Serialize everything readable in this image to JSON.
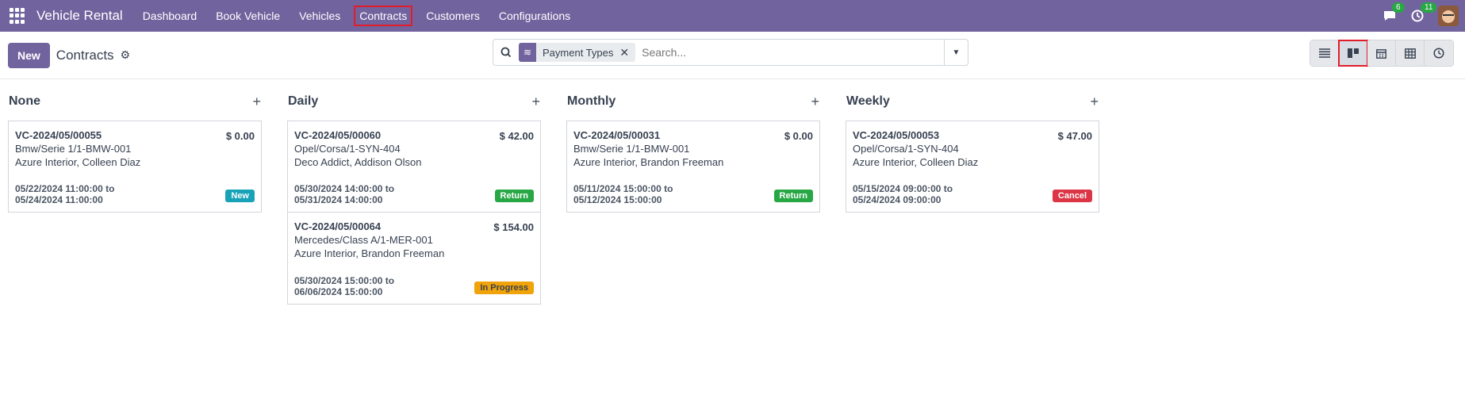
{
  "app": {
    "name": "Vehicle Rental",
    "menu": [
      "Dashboard",
      "Book Vehicle",
      "Vehicles",
      "Contracts",
      "Customers",
      "Configurations"
    ],
    "active_menu": "Contracts",
    "messages_count": "6",
    "activities_count": "11"
  },
  "control": {
    "new_label": "New",
    "title": "Contracts",
    "facet_label": "Payment Types",
    "search_placeholder": "Search..."
  },
  "kanban": {
    "columns": [
      {
        "title": "None",
        "cards": [
          {
            "ref": "VC-2024/05/00055",
            "amount": "$ 0.00",
            "vehicle": "Bmw/Serie 1/1-BMW-001",
            "customer": "Azure Interior, Colleen Diaz",
            "from": "05/22/2024 11:00:00 to",
            "to": "05/24/2024 11:00:00",
            "status": "New",
            "status_color": "#17a2b8"
          }
        ]
      },
      {
        "title": "Daily",
        "cards": [
          {
            "ref": "VC-2024/05/00060",
            "amount": "$ 42.00",
            "vehicle": "Opel/Corsa/1-SYN-404",
            "customer": "Deco Addict, Addison Olson",
            "from": "05/30/2024 14:00:00 to",
            "to": "05/31/2024 14:00:00",
            "status": "Return",
            "status_color": "#28a745"
          },
          {
            "ref": "VC-2024/05/00064",
            "amount": "$ 154.00",
            "vehicle": "Mercedes/Class A/1-MER-001",
            "customer": "Azure Interior, Brandon Freeman",
            "from": "05/30/2024 15:00:00 to",
            "to": "06/06/2024 15:00:00",
            "status": "In Progress",
            "status_color": "#f0a30a"
          }
        ]
      },
      {
        "title": "Monthly",
        "cards": [
          {
            "ref": "VC-2024/05/00031",
            "amount": "$ 0.00",
            "vehicle": "Bmw/Serie 1/1-BMW-001",
            "customer": "Azure Interior, Brandon Freeman",
            "from": "05/11/2024 15:00:00 to",
            "to": "05/12/2024 15:00:00",
            "status": "Return",
            "status_color": "#28a745"
          }
        ]
      },
      {
        "title": "Weekly",
        "cards": [
          {
            "ref": "VC-2024/05/00053",
            "amount": "$ 47.00",
            "vehicle": "Opel/Corsa/1-SYN-404",
            "customer": "Azure Interior, Colleen Diaz",
            "from": "05/15/2024 09:00:00 to",
            "to": "05/24/2024 09:00:00",
            "status": "Cancel",
            "status_color": "#dc3545"
          }
        ]
      }
    ]
  }
}
